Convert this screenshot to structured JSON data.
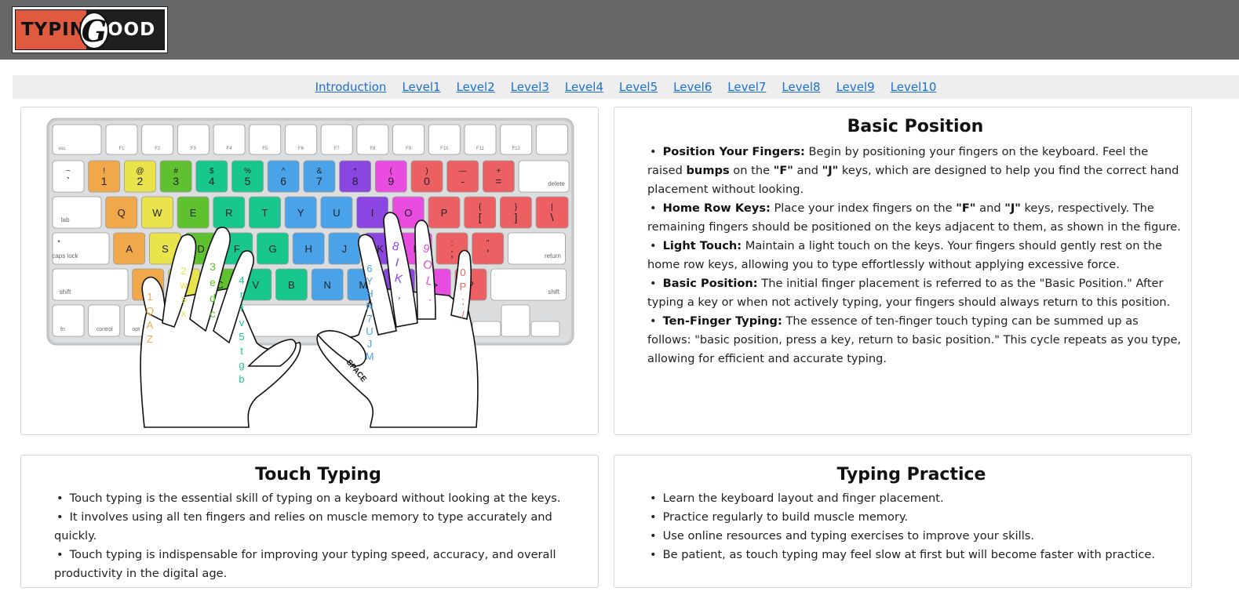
{
  "logo": {
    "left_text": "TYPIN",
    "g_letter": "G",
    "right_text": "OOD"
  },
  "nav": [
    "Introduction",
    "Level1",
    "Level2",
    "Level3",
    "Level4",
    "Level5",
    "Level6",
    "Level7",
    "Level8",
    "Level9",
    "Level10"
  ],
  "keyboard": {
    "colors": {
      "orange": "#f0a84a",
      "yellow": "#e9e34c",
      "green": "#5fc12f",
      "teal": "#17c78e",
      "blue": "#4aa2e8",
      "purple": "#8b45e0",
      "pink": "#e84de0",
      "red": "#ec6063",
      "white": "#ffffff"
    },
    "fn_row": [
      "esc",
      "F1",
      "F2",
      "F3",
      "F4",
      "F5",
      "F6",
      "F7",
      "F8",
      "F9",
      "F10",
      "F11",
      "F12",
      ""
    ],
    "num_row": [
      {
        "top": "~",
        "bottom": "`",
        "c": "white"
      },
      {
        "top": "!",
        "bottom": "1",
        "c": "orange"
      },
      {
        "top": "@",
        "bottom": "2",
        "c": "yellow"
      },
      {
        "top": "#",
        "bottom": "3",
        "c": "green"
      },
      {
        "top": "$",
        "bottom": "4",
        "c": "teal"
      },
      {
        "top": "%",
        "bottom": "5",
        "c": "teal"
      },
      {
        "top": "^",
        "bottom": "6",
        "c": "blue"
      },
      {
        "top": "&",
        "bottom": "7",
        "c": "blue"
      },
      {
        "top": "*",
        "bottom": "8",
        "c": "purple"
      },
      {
        "top": "(",
        "bottom": "9",
        "c": "pink"
      },
      {
        "top": ")",
        "bottom": "0",
        "c": "red"
      },
      {
        "top": "—",
        "bottom": "-",
        "c": "red"
      },
      {
        "top": "+",
        "bottom": "=",
        "c": "red"
      },
      {
        "top": "",
        "bottom": "delete",
        "c": "white"
      }
    ],
    "q_row": [
      {
        "top": "",
        "bottom": "tab",
        "c": "white"
      },
      {
        "top": "",
        "bottom": "Q",
        "c": "orange"
      },
      {
        "top": "",
        "bottom": "W",
        "c": "yellow"
      },
      {
        "top": "",
        "bottom": "E",
        "c": "green"
      },
      {
        "top": "",
        "bottom": "R",
        "c": "teal"
      },
      {
        "top": "",
        "bottom": "T",
        "c": "teal"
      },
      {
        "top": "",
        "bottom": "Y",
        "c": "blue"
      },
      {
        "top": "",
        "bottom": "U",
        "c": "blue"
      },
      {
        "top": "",
        "bottom": "I",
        "c": "purple"
      },
      {
        "top": "",
        "bottom": "O",
        "c": "pink"
      },
      {
        "top": "",
        "bottom": "P",
        "c": "red"
      },
      {
        "top": "{",
        "bottom": "[",
        "c": "red"
      },
      {
        "top": "}",
        "bottom": "]",
        "c": "red"
      },
      {
        "top": "|",
        "bottom": "\\",
        "c": "red"
      }
    ],
    "a_row": [
      {
        "top": "•",
        "bottom": "caps lock",
        "c": "white"
      },
      {
        "top": "",
        "bottom": "A",
        "c": "orange"
      },
      {
        "top": "",
        "bottom": "S",
        "c": "yellow"
      },
      {
        "top": "",
        "bottom": "D",
        "c": "green"
      },
      {
        "top": "",
        "bottom": "F",
        "c": "teal"
      },
      {
        "top": "",
        "bottom": "G",
        "c": "teal"
      },
      {
        "top": "",
        "bottom": "H",
        "c": "blue"
      },
      {
        "top": "",
        "bottom": "J",
        "c": "blue"
      },
      {
        "top": "",
        "bottom": "K",
        "c": "purple"
      },
      {
        "top": "",
        "bottom": "L",
        "c": "pink"
      },
      {
        "top": ":",
        "bottom": ";",
        "c": "red"
      },
      {
        "top": "\"",
        "bottom": "'",
        "c": "red"
      },
      {
        "top": "",
        "bottom": "return",
        "c": "white"
      }
    ],
    "z_row": [
      {
        "top": "",
        "bottom": "shift",
        "c": "white"
      },
      {
        "top": "",
        "bottom": "Z",
        "c": "orange"
      },
      {
        "top": "",
        "bottom": "X",
        "c": "yellow"
      },
      {
        "top": "",
        "bottom": "C",
        "c": "green"
      },
      {
        "top": "",
        "bottom": "V",
        "c": "teal"
      },
      {
        "top": "",
        "bottom": "B",
        "c": "teal"
      },
      {
        "top": "",
        "bottom": "N",
        "c": "blue"
      },
      {
        "top": "",
        "bottom": "M",
        "c": "blue"
      },
      {
        "top": "",
        "bottom": "<",
        "c": "purple"
      },
      {
        "top": "",
        "bottom": ">",
        "c": "pink"
      },
      {
        "top": "",
        "bottom": "?",
        "c": "red"
      },
      {
        "top": "",
        "bottom": "shift",
        "c": "white"
      }
    ],
    "bottom_row": [
      "fn",
      "control",
      "opt"
    ],
    "finger_labels": {
      "left_pinky": "1QAZ",
      "left_ring": "2wsx",
      "left_middle": "3edc",
      "left_index": "4rfv5tgb",
      "right_index": "6YHN7UJM",
      "right_middle": "8IK,",
      "right_ring": "9OL.",
      "right_pinky": "0P;/"
    },
    "space_label": "SPACE"
  },
  "basic": {
    "title": "Basic Position",
    "items": [
      {
        "label": "Position Your Fingers:",
        "text_a": " Begin by positioning your fingers on the keyboard. Feel the raised ",
        "bold_a": "bumps",
        "text_b": " on the ",
        "bold_b": "\"F\"",
        "text_c": " and ",
        "bold_c": "\"J\"",
        "text_d": " keys, which are designed to help you find the correct hand placement without looking."
      },
      {
        "label": "Home Row Keys:",
        "text_a": " Place your index fingers on the ",
        "bold_a": "\"F\"",
        "text_b": " and ",
        "bold_b": "\"J\"",
        "text_c": " keys, respectively. The remaining fingers should be positioned on the keys adjacent to them, as shown in the figure.",
        "bold_c": "",
        "text_d": ""
      },
      {
        "label": "Light Touch:",
        "text_a": " Maintain a light touch on the keys. Your fingers should gently rest on the home row keys, allowing you to type effortlessly without applying excessive force.",
        "bold_a": "",
        "text_b": "",
        "bold_b": "",
        "text_c": "",
        "bold_c": "",
        "text_d": ""
      },
      {
        "label": "Basic Position:",
        "text_a": " The initial finger placement is referred to as the \"Basic Position.\" After typing a key or when not actively typing, your fingers should always return to this position.",
        "bold_a": "",
        "text_b": "",
        "bold_b": "",
        "text_c": "",
        "bold_c": "",
        "text_d": ""
      },
      {
        "label": "Ten-Finger Typing:",
        "text_a": " The essence of ten-finger touch typing can be summed up as follows: \"basic position, press a key, return to basic position.\" This cycle repeats as you type, allowing for efficient and accurate typing.",
        "bold_a": "",
        "text_b": "",
        "bold_b": "",
        "text_c": "",
        "bold_c": "",
        "text_d": ""
      }
    ]
  },
  "touch": {
    "title": "Touch Typing",
    "items": [
      "Touch typing is the essential skill of typing on a keyboard without looking at the keys.",
      "It involves using all ten fingers and relies on muscle memory to type accurately and quickly.",
      "Touch typing is indispensable for improving your typing speed, accuracy, and overall productivity in the digital age."
    ]
  },
  "practice": {
    "title": "Typing Practice",
    "items": [
      "Learn the keyboard layout and finger placement.",
      "Practice regularly to build muscle memory.",
      "Use online resources and typing exercises to improve your skills.",
      "Be patient, as touch typing may feel slow at first but will become faster with practice."
    ]
  }
}
